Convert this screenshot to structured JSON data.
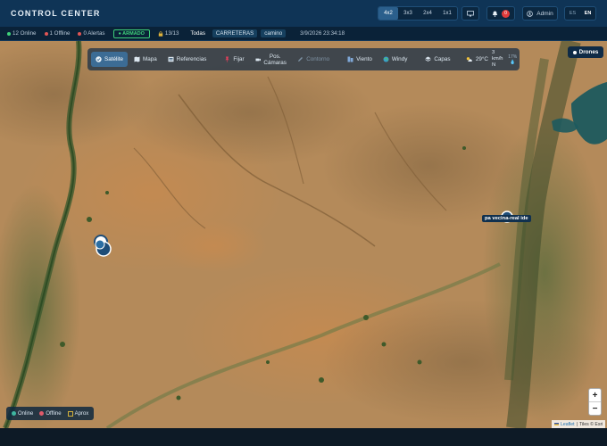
{
  "header": {
    "title": "CONTROL CENTER",
    "grid_options": [
      "4x2",
      "3x3",
      "2x4",
      "1x1"
    ],
    "active_grid": "4x2",
    "monitor_icon": "monitor-icon",
    "notifications": {
      "icon": "bell-icon",
      "count": "0"
    },
    "user": {
      "icon": "user-icon",
      "label": "Admin"
    },
    "languages": [
      "ES",
      "EN"
    ],
    "active_language": "EN"
  },
  "statusbar": {
    "online": "12 Online",
    "offline": "1 Offline",
    "alerts": "0 Alertas",
    "armed": "ARMADO",
    "lock_count": "13/13",
    "filters": [
      "Todas",
      "CARRETERAS",
      "camino"
    ],
    "datetime": "3/9/2026 23:34:18",
    "colors": {
      "online": "#3fd27a",
      "offline": "#e05555",
      "alerts": "#e05555"
    }
  },
  "toolbar": {
    "items": [
      {
        "label": "Satélite",
        "icon": "check-icon",
        "active": true
      },
      {
        "label": "Mapa",
        "icon": "map-icon",
        "active": false
      },
      {
        "label": "Referencias",
        "icon": "reference-icon",
        "active": false
      },
      {
        "label": "Fijar",
        "icon": "pin-icon",
        "active": false
      },
      {
        "label": "Pos. Cámaras",
        "icon": "camera-icon",
        "active": false
      },
      {
        "label": "Contorno",
        "icon": "pencil-icon",
        "active": false,
        "disabled": true
      },
      {
        "label": "Viento",
        "icon": "wind-icon",
        "active": false
      },
      {
        "label": "Windy",
        "icon": "globe-icon",
        "active": false
      },
      {
        "label": "Capas",
        "icon": "layers-icon",
        "active": false
      }
    ],
    "weather": {
      "temp": "29°C",
      "wind_speed": "3 km/h",
      "wind_dir": "N",
      "humidity": "17%"
    }
  },
  "drones": {
    "label": "Drones"
  },
  "map": {
    "marker_label": "pa vecina-real ide",
    "legend": {
      "online": "Online",
      "offline": "Offline",
      "aprox": "Aprox"
    },
    "zoom_in": "+",
    "zoom_out": "−",
    "attribution": {
      "leaflet": "Leaflet",
      "tiles": "Tiles © Esri"
    }
  }
}
